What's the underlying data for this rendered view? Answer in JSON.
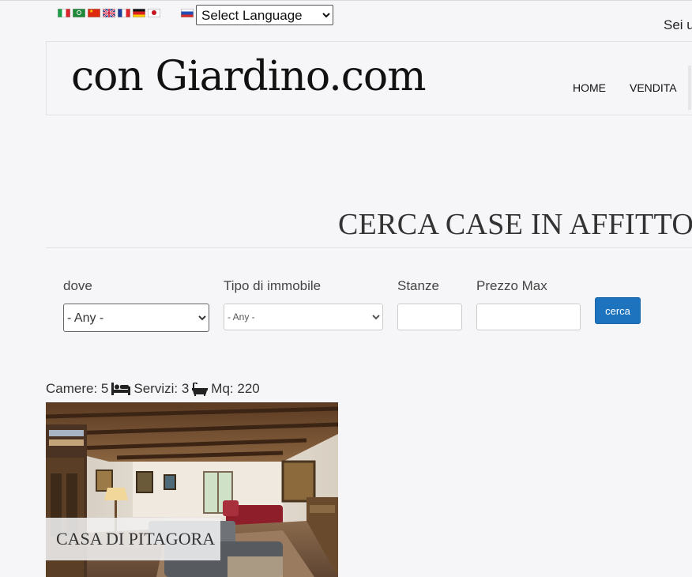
{
  "language": {
    "select_label": "Select Language",
    "flags": [
      "italian-flag-icon",
      "arabic-flag-icon",
      "chinese-flag-icon",
      "english-flag-icon",
      "french-flag-icon",
      "german-flag-icon",
      "japanese-flag-icon"
    ],
    "russian_flag": "russian-flag-icon"
  },
  "userbar": {
    "text": "Sei u"
  },
  "header": {
    "logo": "con Giardino.com",
    "nav": [
      "HOME",
      "VENDITA"
    ]
  },
  "section": {
    "title": "CERCA CASE IN AFFITTO"
  },
  "search": {
    "dove_label": "dove",
    "dove_value": "- Any -",
    "tipo_label": "Tipo di immobile",
    "tipo_value": "- Any -",
    "stanze_label": "Stanze",
    "prezzo_label": "Prezzo Max",
    "button": "cerca"
  },
  "listing": {
    "camere_label": "Camere: 5",
    "servizi_label": "Servizi: 3",
    "mq_label": "Mq: 220",
    "title": "CASA DI PITAGORA"
  },
  "colors": {
    "accent": "#1e73be",
    "background": "#f6f6f8"
  }
}
